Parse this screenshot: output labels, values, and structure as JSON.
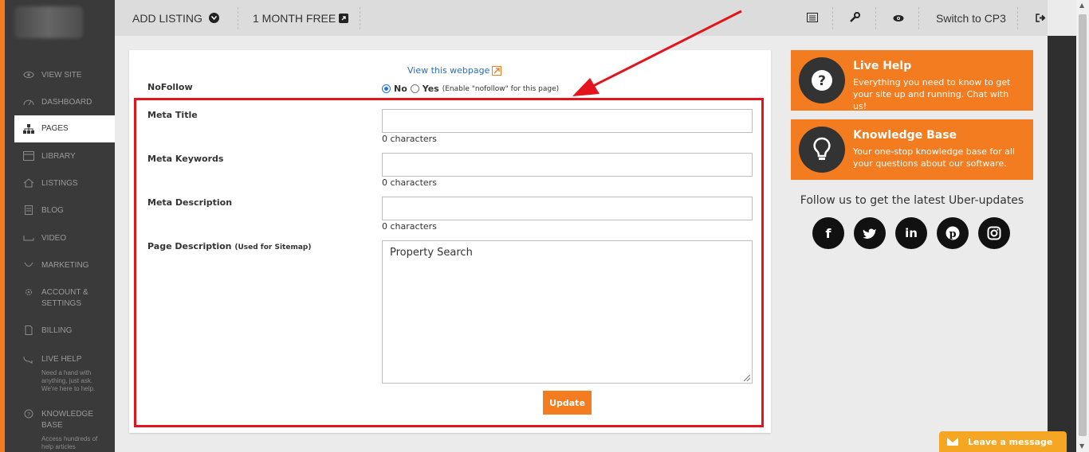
{
  "sidebar": {
    "items": [
      {
        "label": "VIEW SITE",
        "icon": "eye-icon"
      },
      {
        "label": "DASHBOARD",
        "icon": "gauge-icon"
      },
      {
        "label": "PAGES",
        "icon": "sitemap-icon"
      },
      {
        "label": "LIBRARY",
        "icon": "image-icon"
      },
      {
        "label": "LISTINGS",
        "icon": "home-icon"
      },
      {
        "label": "BLOG",
        "icon": "document-icon"
      },
      {
        "label": "VIDEO",
        "icon": "video-icon"
      },
      {
        "label": "MARKETING",
        "icon": "megaphone-icon"
      },
      {
        "label": "ACCOUNT & SETTINGS",
        "icon": "gear-icon"
      },
      {
        "label": "BILLING",
        "icon": "file-icon"
      },
      {
        "label": "LIVE HELP",
        "icon": "chat-icon",
        "sub": "Need a hand with anything, just ask. We're here to help."
      },
      {
        "label": "KNOWLEDGE BASE",
        "icon": "question-icon",
        "sub": "Access hundreds of help articles"
      }
    ],
    "active": "PAGES"
  },
  "topbar": {
    "add_listing": "ADD LISTING",
    "month_free": "1 MONTH FREE",
    "switch": "Switch to CP3",
    "icons": [
      "list-icon",
      "wrench-icon",
      "eye-icon",
      "sign-out-icon"
    ]
  },
  "form": {
    "view_link": "View this webpage",
    "nofollow_label": "NoFollow",
    "nofollow_no": "No",
    "nofollow_yes": "Yes",
    "nofollow_hint": "(Enable \"nofollow\" for this page)",
    "nofollow_selected": "No",
    "meta_title_label": "Meta Title",
    "meta_title_value": "",
    "meta_title_count": "0 characters",
    "meta_keywords_label": "Meta Keywords",
    "meta_keywords_value": "",
    "meta_keywords_count": "0 characters",
    "meta_description_label": "Meta Description",
    "meta_description_value": "",
    "meta_description_count": "0 characters",
    "page_description_label": "Page Description",
    "page_description_note": "(Used for Sitemap)",
    "page_description_value": "Property Search",
    "update_button": "Update"
  },
  "right_panel": {
    "live_help": {
      "title": "Live Help",
      "desc": "Everything you need to know to get your site up and running. Chat with us!"
    },
    "knowledge_base": {
      "title": "Knowledge Base",
      "desc": "Your one-stop knowledge base for all your questions about our software."
    },
    "follow_text": "Follow us to get the latest Uber-updates",
    "socials": [
      "facebook-icon",
      "twitter-icon",
      "linkedin-icon",
      "pinterest-icon",
      "instagram-icon"
    ]
  },
  "chat": {
    "label": "Leave a message"
  },
  "colors": {
    "accent": "#f37b20",
    "highlight": "#e3141b",
    "link": "#2a6ebb",
    "sidebar_bg": "#3a3a3a"
  }
}
